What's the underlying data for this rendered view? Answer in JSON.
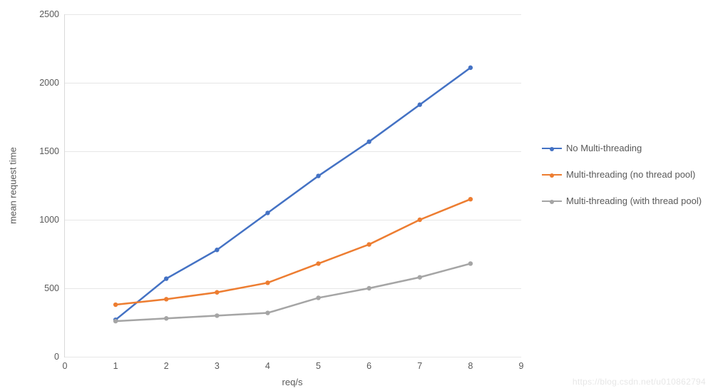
{
  "chart_data": {
    "type": "line",
    "xlabel": "req/s",
    "ylabel": "mean request time",
    "xlim": [
      0,
      9
    ],
    "ylim": [
      0,
      2500
    ],
    "x_ticks": [
      0,
      1,
      2,
      3,
      4,
      5,
      6,
      7,
      8,
      9
    ],
    "y_ticks": [
      0,
      500,
      1000,
      1500,
      2000,
      2500
    ],
    "categories": [
      1,
      2,
      3,
      4,
      5,
      6,
      7,
      8
    ],
    "series": [
      {
        "name": "No Multi-threading",
        "color": "#4472C4",
        "values": [
          270,
          570,
          780,
          1050,
          1320,
          1570,
          1840,
          2110
        ]
      },
      {
        "name": "Multi-threading (no thread pool)",
        "color": "#ED7D31",
        "values": [
          380,
          420,
          470,
          540,
          680,
          820,
          1000,
          1150
        ]
      },
      {
        "name": "Multi-threading (with thread pool)",
        "color": "#A5A5A5",
        "values": [
          260,
          280,
          300,
          320,
          430,
          500,
          580,
          680
        ]
      }
    ],
    "legend_position": "right",
    "grid": {
      "horizontal": true,
      "vertical": false
    }
  },
  "watermark": "https://blog.csdn.net/u010862794"
}
